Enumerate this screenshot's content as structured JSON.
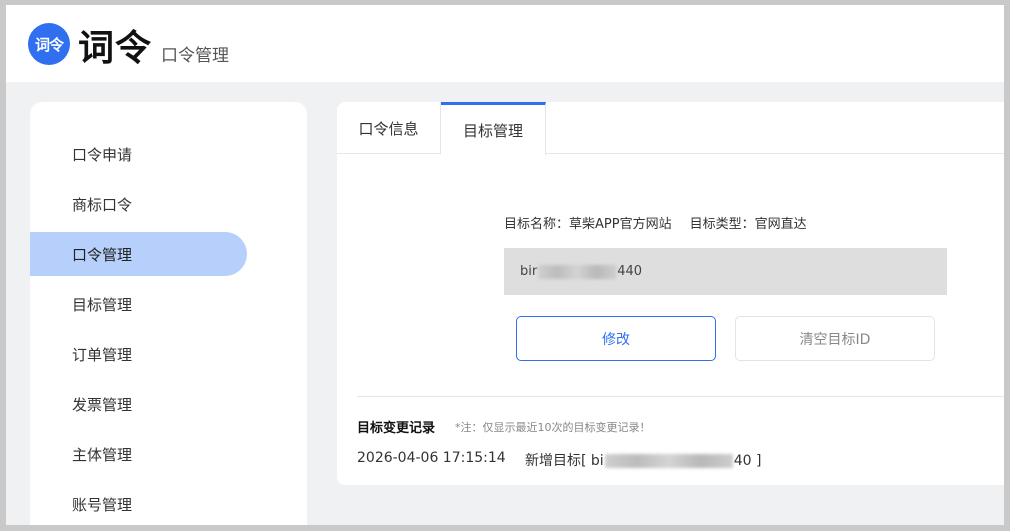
{
  "header": {
    "logo_text": "词令",
    "brand": "词令",
    "subtitle": "口令管理"
  },
  "sidebar": {
    "items": [
      {
        "label": "口令申请"
      },
      {
        "label": "商标口令"
      },
      {
        "label": "口令管理",
        "active": true
      },
      {
        "label": "目标管理"
      },
      {
        "label": "订单管理"
      },
      {
        "label": "发票管理"
      },
      {
        "label": "主体管理"
      },
      {
        "label": "账号管理"
      }
    ]
  },
  "main": {
    "tabs": [
      {
        "label": "口令信息"
      },
      {
        "label": "目标管理",
        "active": true
      }
    ],
    "target_name_label": "目标名称：",
    "target_name": "草柴APP官方网站",
    "target_type_label": "目标类型：",
    "target_type": "官网直达",
    "target_id_prefix": "bir",
    "target_id_suffix": "440",
    "edit_button": "修改",
    "clear_button": "清空目标ID",
    "record_title": "目标变更记录",
    "record_note": "*注：仅显示最近10次的目标变更记录！",
    "records": [
      {
        "time": "2026-04-06 17:15:14",
        "text_prefix": "新增目标[ bi",
        "text_suffix": "40 ]"
      }
    ]
  },
  "colors": {
    "accent": "#2f6ff0",
    "active_nav_bg": "#b6d0fb",
    "page_bg": "#f0f1f2"
  }
}
